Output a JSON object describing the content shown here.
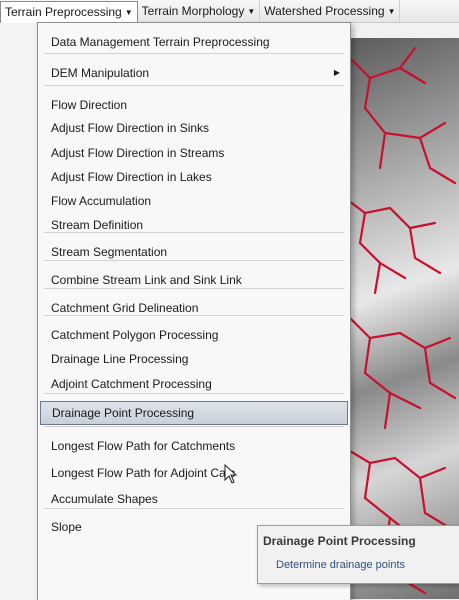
{
  "menubar": [
    {
      "label": "Terrain Preprocessing",
      "active": true
    },
    {
      "label": "Terrain Morphology",
      "active": false
    },
    {
      "label": "Watershed Processing",
      "active": false
    }
  ],
  "menu": {
    "items": [
      {
        "label": "Data Management Terrain Preprocessing"
      },
      {
        "label": "DEM Manipulation",
        "submenu": true
      },
      {
        "label": "Flow Direction"
      },
      {
        "label": "Adjust Flow Direction in Sinks"
      },
      {
        "label": "Adjust Flow Direction in Streams"
      },
      {
        "label": "Adjust Flow Direction in Lakes"
      },
      {
        "label": "Flow Accumulation"
      },
      {
        "label": "Stream Definition"
      },
      {
        "label": "Stream Segmentation"
      },
      {
        "label": "Combine Stream Link and Sink Link"
      },
      {
        "label": "Catchment Grid Delineation"
      },
      {
        "label": "Catchment Polygon Processing"
      },
      {
        "label": "Drainage Line Processing"
      },
      {
        "label": "Adjoint Catchment Processing"
      },
      {
        "label": "Drainage Point Processing",
        "highlighted": true
      },
      {
        "label": "Longest Flow Path for Catchments"
      },
      {
        "label": "Longest Flow Path for Adjoint Catc"
      },
      {
        "label": "Accumulate Shapes"
      },
      {
        "label": "Slope"
      }
    ]
  },
  "tooltip": {
    "title": "Drainage Point Processing",
    "description": "Determine drainage points"
  },
  "colors": {
    "stream": "#c8102e",
    "highlight_border": "#6b7a8c",
    "tooltip_link": "#2f4f82"
  }
}
